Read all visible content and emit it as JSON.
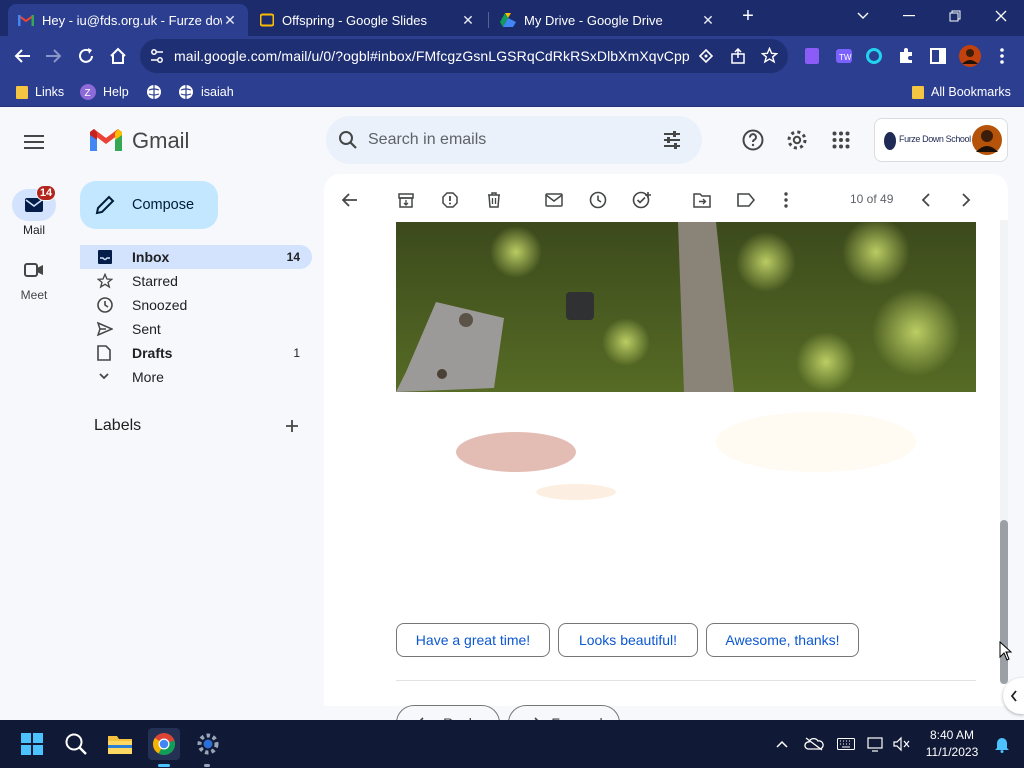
{
  "browser": {
    "tabs": [
      {
        "title": "Hey - iu@fds.org.uk - Furze down",
        "active": true
      },
      {
        "title": "Offspring - Google Slides",
        "active": false
      },
      {
        "title": "My Drive - Google Drive",
        "active": false
      }
    ],
    "url": "mail.google.com/mail/u/0/?ogbl#inbox/FMfcgzGsnLGSRqCdRkRSxDlbXmXqvCpp",
    "bookmarks": [
      "Links",
      "Help",
      "isaiah"
    ],
    "all_bookmarks_label": "All Bookmarks",
    "colors": {
      "frame": "#1b2b6b",
      "toolbar": "#2c3e8f"
    }
  },
  "gmail": {
    "product_name": "Gmail",
    "search_placeholder": "Search in emails",
    "account_brand": "Furze Down School",
    "rail": {
      "mail_label": "Mail",
      "mail_badge": "14",
      "meet_label": "Meet"
    },
    "compose_label": "Compose",
    "nav": [
      {
        "label": "Inbox",
        "count": "14",
        "icon": "inbox-icon",
        "selected": true,
        "bold": true
      },
      {
        "label": "Starred",
        "count": "",
        "icon": "star-icon",
        "selected": false,
        "bold": false
      },
      {
        "label": "Snoozed",
        "count": "",
        "icon": "clock-icon",
        "selected": false,
        "bold": false
      },
      {
        "label": "Sent",
        "count": "",
        "icon": "send-icon",
        "selected": false,
        "bold": false
      },
      {
        "label": "Drafts",
        "count": "1",
        "icon": "draft-icon",
        "selected": false,
        "bold": true
      },
      {
        "label": "More",
        "count": "",
        "icon": "chevron-down-icon",
        "selected": false,
        "bold": false
      }
    ],
    "labels_heading": "Labels",
    "pagination": "10 of 49",
    "smart_replies": [
      "Have a great time!",
      "Looks beautiful!",
      "Awesome, thanks!"
    ],
    "reply_label": "Reply",
    "forward_label": "Forward"
  },
  "taskbar": {
    "time": "8:40 AM",
    "date": "11/1/2023"
  }
}
